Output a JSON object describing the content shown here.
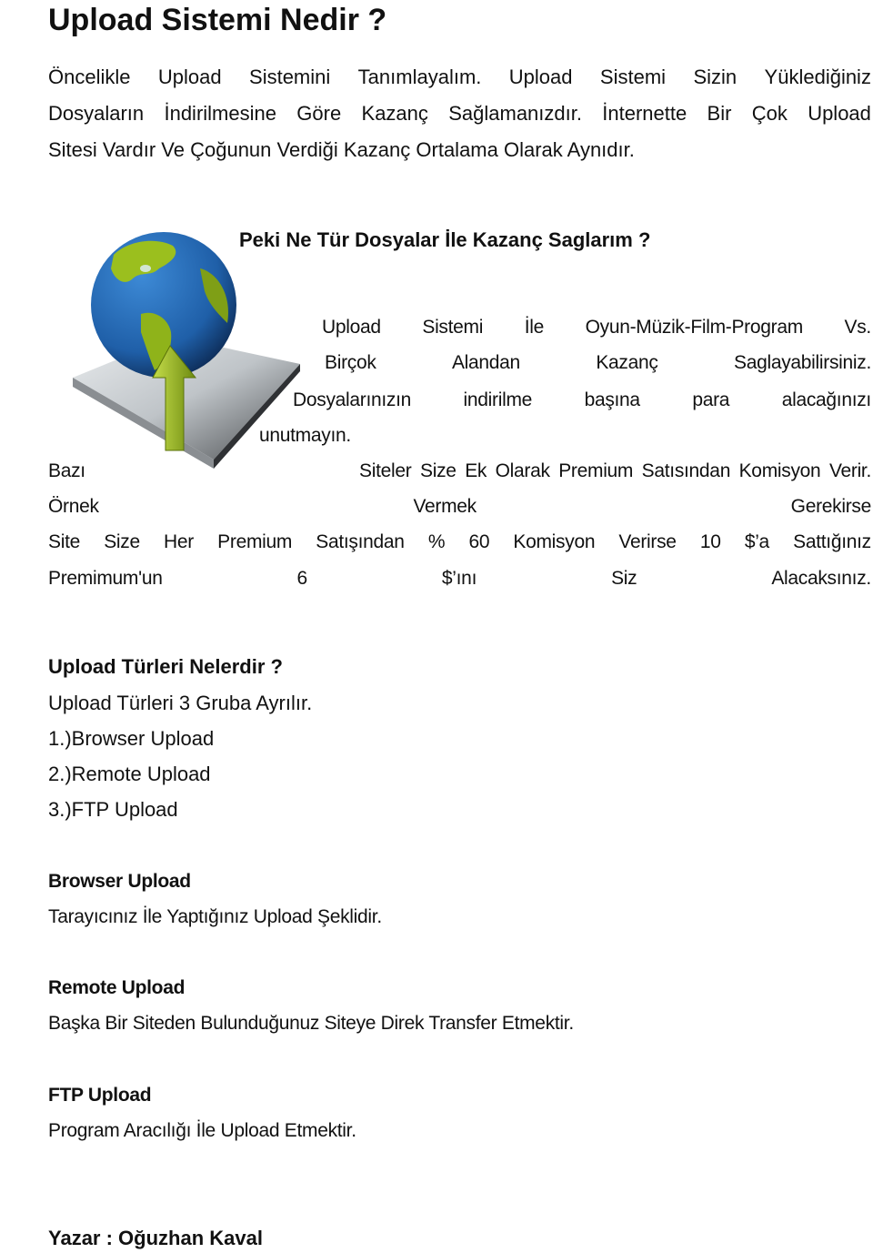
{
  "title": "Upload Sistemi Nedir ?",
  "intro": {
    "line1_words": [
      "Öncelikle",
      "Upload",
      "Sistemini",
      "Tanımlayalım.",
      "Upload",
      "Sistemi",
      "Sizin",
      "Yüklediğiniz"
    ],
    "line2_words": [
      "Dosyaların",
      "İndirilmesine",
      "Göre",
      "Kazanç",
      "Sağlamanızdır.",
      "İnternette",
      "Bir",
      "Çok",
      "Upload"
    ],
    "line3": "Sitesi Vardır Ve Çoğunun Verdiği Kazanç Ortalama Olarak Aynıdır."
  },
  "section_question": "Peki Ne Tür Dosyalar İle Kazanç Saglarım ?",
  "section_body": {
    "line1_words": [
      "Upload",
      "Sistemi",
      "İle",
      "Oyun-Müzik-Film-Program",
      "Vs."
    ],
    "line2_words": [
      "Birçok",
      "Alandan",
      "Kazanç",
      "Saglayabilirsiniz."
    ],
    "line3_words": [
      "Dosyalarınızın",
      "indirilme",
      "başına",
      "para",
      "alacağınızı"
    ],
    "line4": "unutmayın."
  },
  "premium": {
    "line1_words": [
      "Bazı",
      "Siteler Size Ek Olarak Premium Satısından Komisyon Verir."
    ],
    "line2_words": [
      "Örnek",
      "Vermek",
      "Gerekirse"
    ],
    "line3_words": [
      "Site",
      "Size",
      "Her",
      "Premium",
      "Satışından",
      "%",
      "60",
      "Komisyon",
      "Verirse",
      "10",
      "$’a",
      "Sattığınız"
    ],
    "line4_words": [
      "Premimum'un",
      "6",
      "$’ını",
      "Siz",
      "Alacaksınız."
    ]
  },
  "types": {
    "heading": "Upload Türleri Nelerdir ?",
    "intro": "Upload Türleri 3 Gruba Ayrılır.",
    "items": [
      "1.)Browser Upload",
      "2.)Remote Upload",
      "3.)FTP Upload"
    ]
  },
  "definitions": [
    {
      "heading": "Browser Upload",
      "text": "Tarayıcınız İle Yaptığınız Upload Şeklidir."
    },
    {
      "heading": "Remote Upload",
      "text": "Başka Bir Siteden Bulunduğunuz Siteye Direk Transfer Etmektir."
    },
    {
      "heading": "FTP Upload",
      "text": "Program Aracılığı İle Upload Etmektir."
    }
  ],
  "author": "Yazar : Oğuzhan Kaval",
  "illustration": {
    "icon": "globe-upload-icon",
    "colors": {
      "ocean": "#1f5fa8",
      "land": "#9bbf1e",
      "arrow": "#8fb31a",
      "platform": "#cfd3d6"
    }
  }
}
